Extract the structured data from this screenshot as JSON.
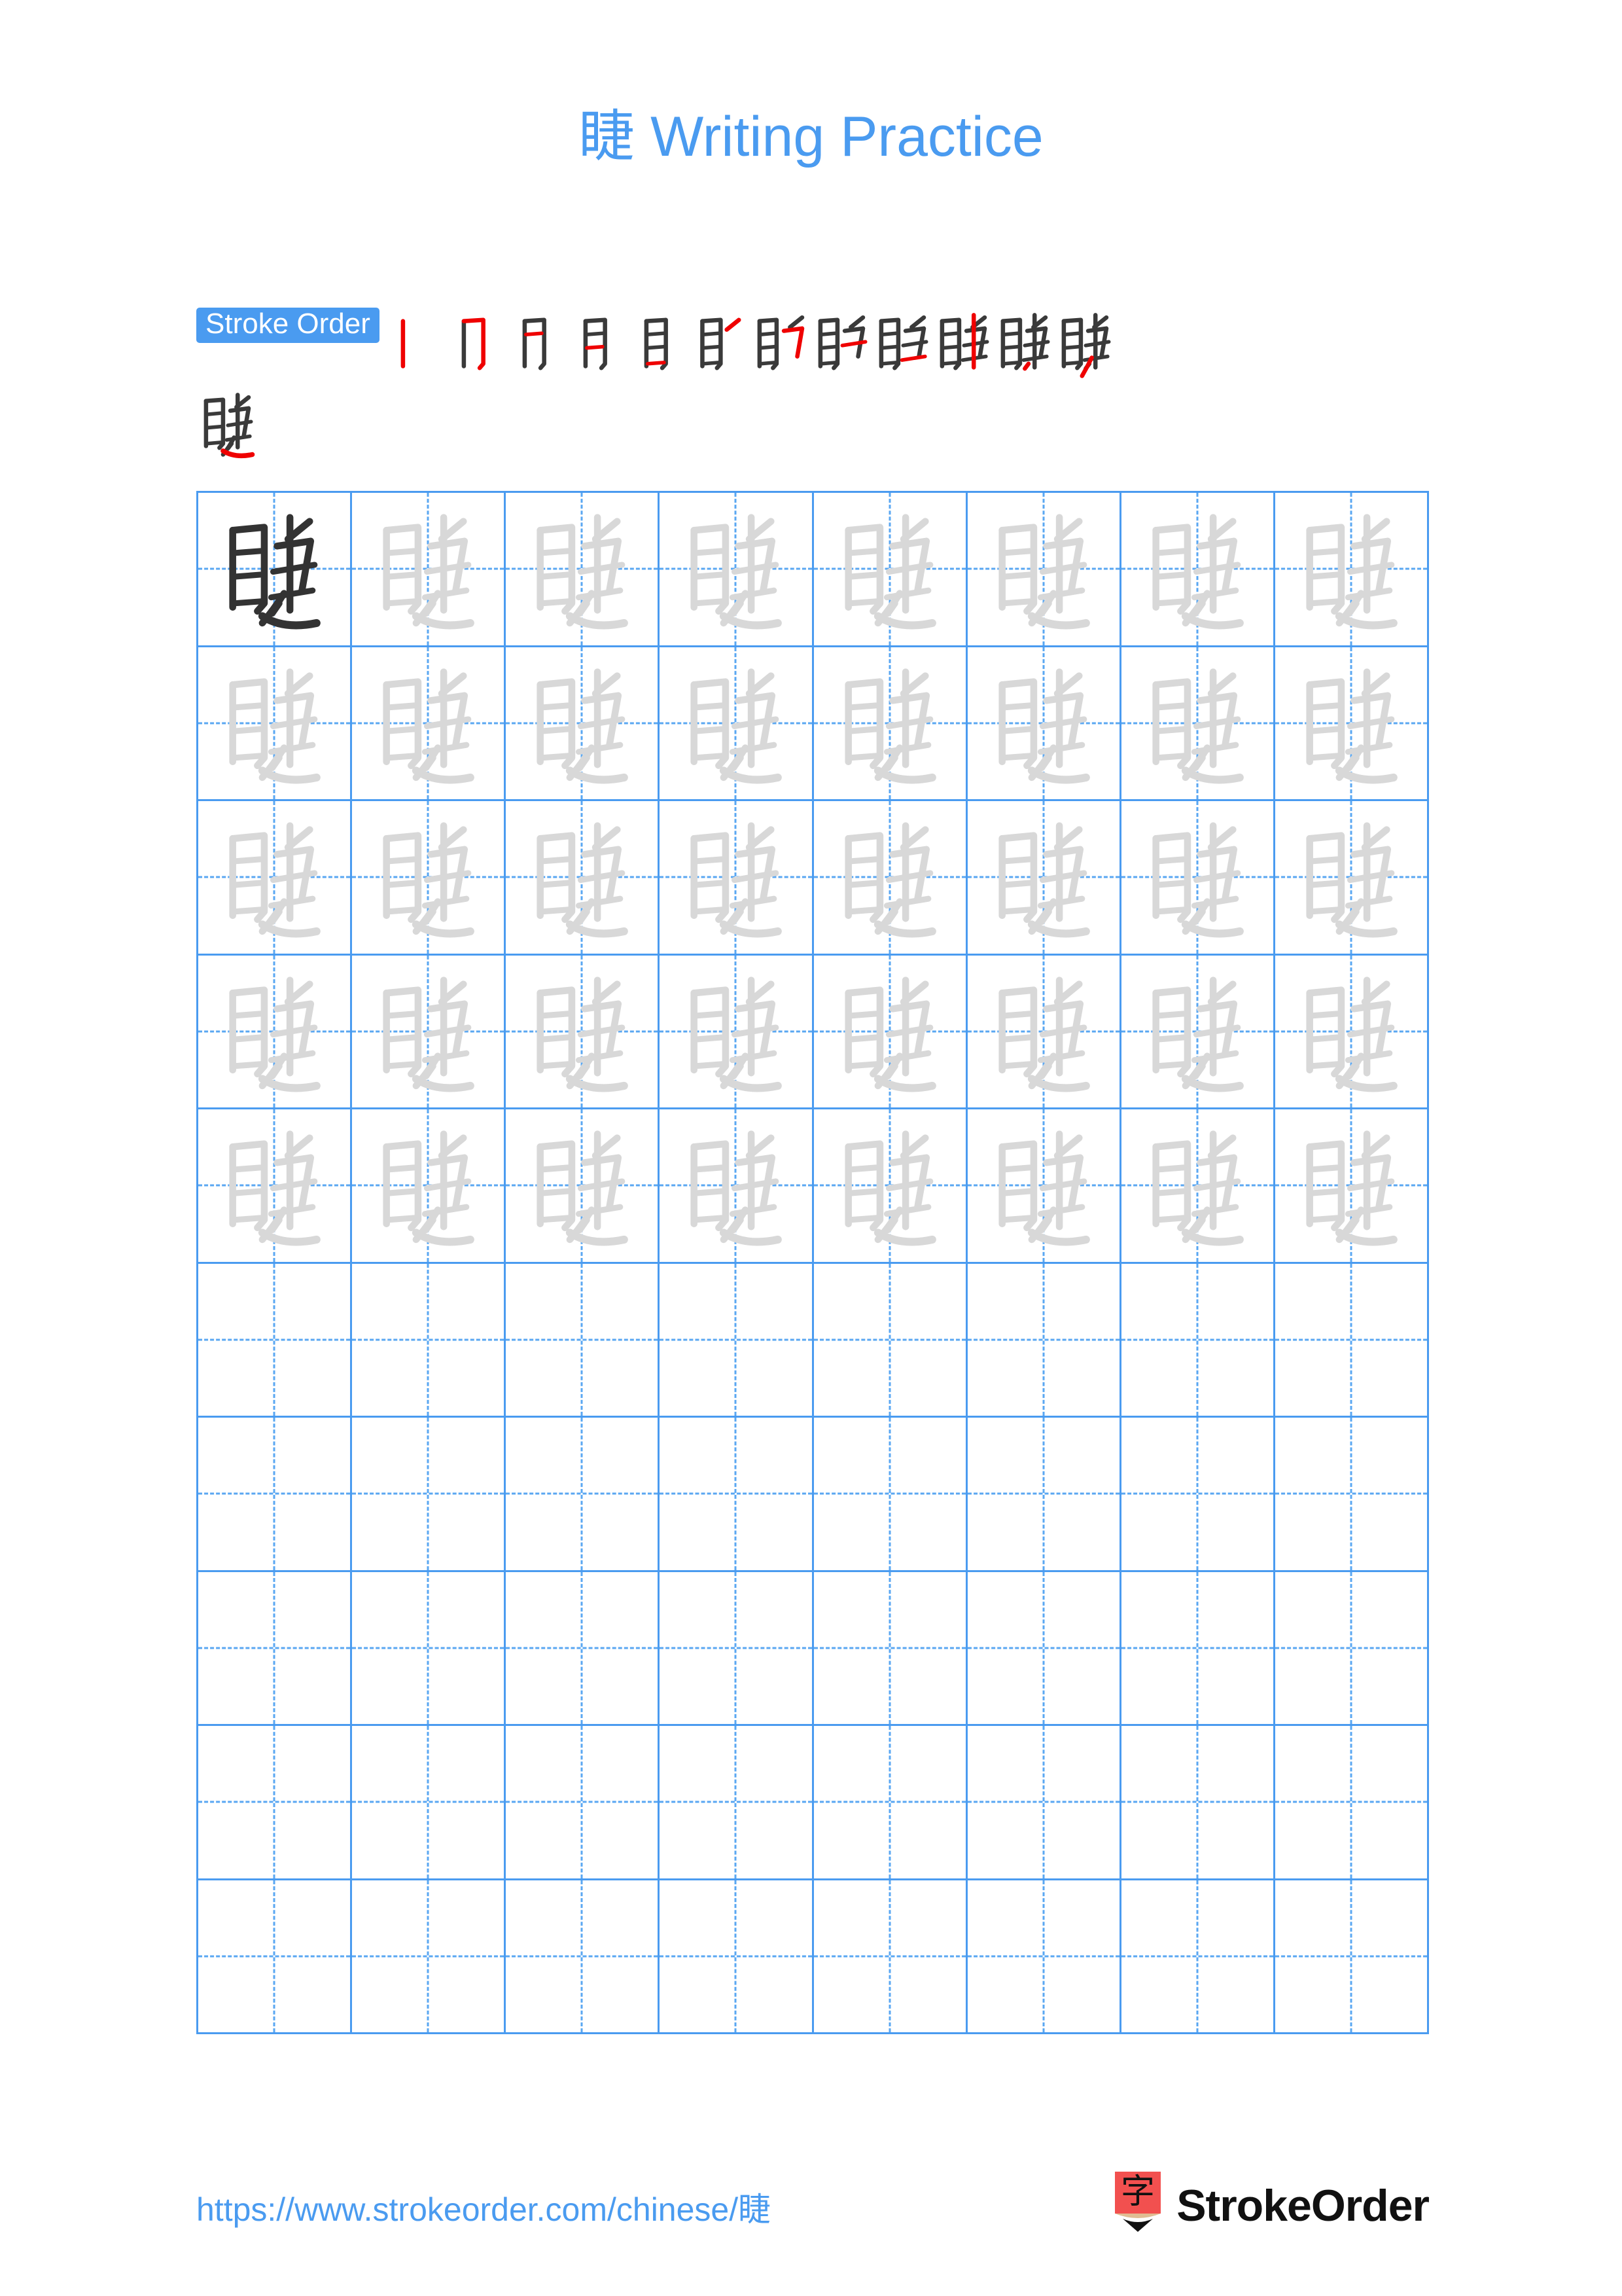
{
  "character": "睫",
  "title": "睫 Writing Practice",
  "colors": {
    "accent_blue": "#4a9bf0",
    "grid_line": "#4a9bf0",
    "grid_guide": "#5aa7f2",
    "model_char": "#333333",
    "trace_char": "#d8d8d8",
    "new_stroke_red": "#ef0000",
    "prev_stroke_dark": "#3a3a3a",
    "brand_text": "#111111",
    "pencil_body": "#f2504f",
    "pencil_wood": "#e0bd92",
    "page_background": "#ffffff"
  },
  "stroke_order": {
    "label": "Stroke Order",
    "total_strokes": 13,
    "steps": [
      {
        "index": 1,
        "new_stroke": "vertical (竖)"
      },
      {
        "index": 2,
        "new_stroke": "horizontal-fold-hook (橫折鉤)"
      },
      {
        "index": 3,
        "new_stroke": "horizontal (橫)"
      },
      {
        "index": 4,
        "new_stroke": "horizontal (橫)"
      },
      {
        "index": 5,
        "new_stroke": "horizontal (橫)"
      },
      {
        "index": 6,
        "new_stroke": "horizontal (橫)"
      },
      {
        "index": 7,
        "new_stroke": "horizontal-fold-hook (橫折鉤)"
      },
      {
        "index": 8,
        "new_stroke": "horizontal (橫)"
      },
      {
        "index": 9,
        "new_stroke": "horizontal (橫)"
      },
      {
        "index": 10,
        "new_stroke": "vertical (竖)"
      },
      {
        "index": 11,
        "new_stroke": "dot (點)"
      },
      {
        "index": 12,
        "new_stroke": "press-down (捺)"
      },
      {
        "index": 13,
        "new_stroke": "flat-press (平捺)"
      }
    ]
  },
  "practice_grid": {
    "columns": 8,
    "rows": 10,
    "filled_rows": 5,
    "empty_rows": 5,
    "model_cell": {
      "row": 1,
      "column": 1,
      "style": "dark"
    },
    "trace_cell_style": "light-gray",
    "guide_style": "dashed-crosshair"
  },
  "footer": {
    "url": "https://www.strokeorder.com/chinese/睫",
    "brand_name": "StrokeOrder",
    "logo_character": "字"
  }
}
